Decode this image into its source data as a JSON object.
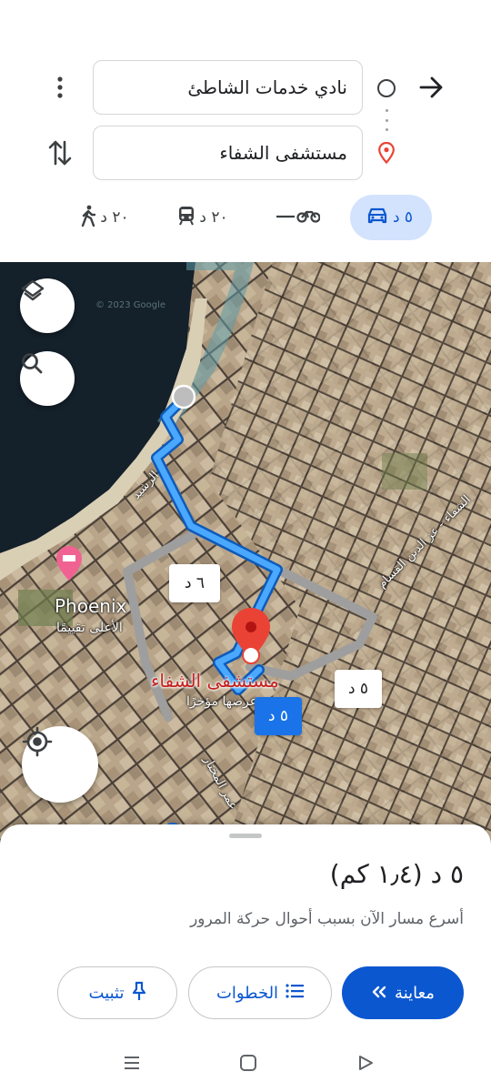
{
  "search": {
    "origin": "نادي خدمات الشاطئ",
    "destination": "مستشفى الشفاء"
  },
  "modes": [
    {
      "name": "driving",
      "label": "٥ د",
      "active": true
    },
    {
      "name": "motorcycle",
      "label": "",
      "active": false
    },
    {
      "name": "transit",
      "label": "٢٠ د",
      "active": false
    },
    {
      "name": "walking",
      "label": "٢٠ د",
      "active": false
    }
  ],
  "map": {
    "copyright": "© 2023 Google",
    "poi_name": "Phoenix",
    "poi_sub": "الأعلى تقييمًا",
    "dest_name": "مستشفى الشفاء",
    "dest_sub": "عرضها مؤخرًا",
    "street_rashid": "الرشيد",
    "street_shifa": "الشفاء - عز الدين القسام",
    "street_omar": "عمر المختار",
    "route_alt1": "٦ د",
    "route_alt2": "٥ د",
    "route_main": "٥ د"
  },
  "sheet": {
    "summary": "٥ د (١٫٤ كم)",
    "subtitle": "أسرع مسار الآن بسبب أحوال حركة المرور",
    "preview_label": "معاينة",
    "steps_label": "الخطوات",
    "pin_label": "تثبيت"
  },
  "colors": {
    "accent": "#0b57d0",
    "route": "#1a73e8",
    "active_tab": "#d3e3fd",
    "pin": "#ea4335"
  }
}
